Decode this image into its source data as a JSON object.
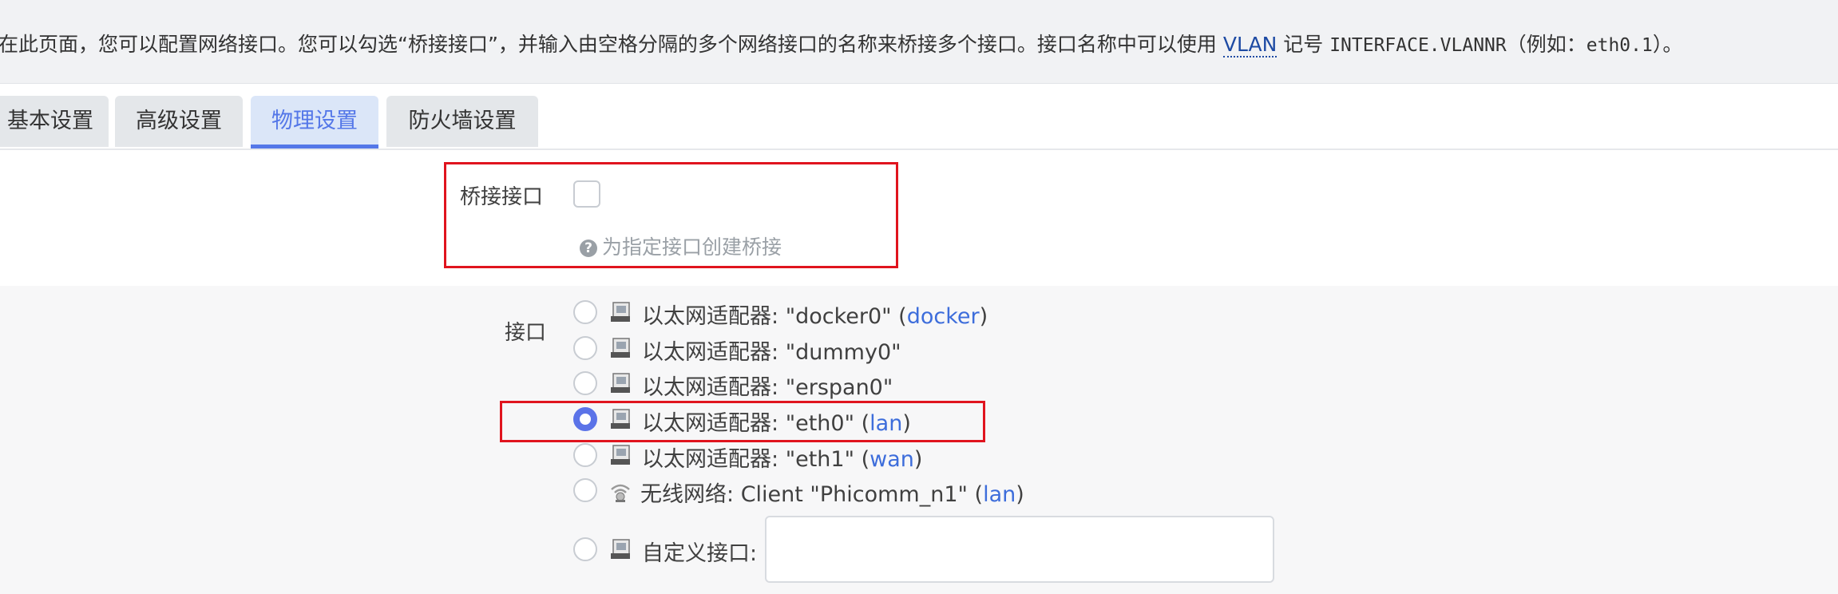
{
  "description": {
    "text_before": "在此页面，您可以配置网络接口。您可以勾选“桥接接口”，并输入由空格分隔的多个网络接口的名称来桥接多个接口。接口名称中可以使用 ",
    "vlan_link": "VLAN",
    "text_mid": " 记号 ",
    "code1": "INTERFACE.VLANNR",
    "text_mid2": "（例如：",
    "code2": "eth0.1",
    "text_after": "）。"
  },
  "tabs": [
    {
      "label": "基本设置",
      "active": false
    },
    {
      "label": "高级设置",
      "active": false
    },
    {
      "label": "物理设置",
      "active": true
    },
    {
      "label": "防火墙设置",
      "active": false
    }
  ],
  "bridge": {
    "label": "桥接接口",
    "checked": false,
    "hint": "为指定接口创建桥接"
  },
  "interface": {
    "label": "接口",
    "options": [
      {
        "prefix": "以太网适配器: ",
        "name": "\"docker0\"",
        "network": "docker",
        "icon": "ethernet-icon",
        "checked": false
      },
      {
        "prefix": "以太网适配器: ",
        "name": "\"dummy0\"",
        "network": "",
        "icon": "ethernet-icon",
        "checked": false
      },
      {
        "prefix": "以太网适配器: ",
        "name": "\"erspan0\"",
        "network": "",
        "icon": "ethernet-icon",
        "checked": false
      },
      {
        "prefix": "以太网适配器: ",
        "name": "\"eth0\"",
        "network": "lan",
        "icon": "ethernet-icon",
        "checked": true
      },
      {
        "prefix": "以太网适配器: ",
        "name": "\"eth1\"",
        "network": "wan",
        "icon": "ethernet-icon",
        "checked": false
      },
      {
        "prefix": "无线网络: ",
        "name": "Client \"Phicomm_n1\"",
        "network": "lan",
        "icon": "wifi-icon",
        "checked": false
      }
    ],
    "custom_label": "自定义接口:",
    "custom_value": ""
  },
  "colors": {
    "accent": "#5477e8",
    "highlight_box": "#e0141e",
    "network_link": "#3d6ddb"
  }
}
